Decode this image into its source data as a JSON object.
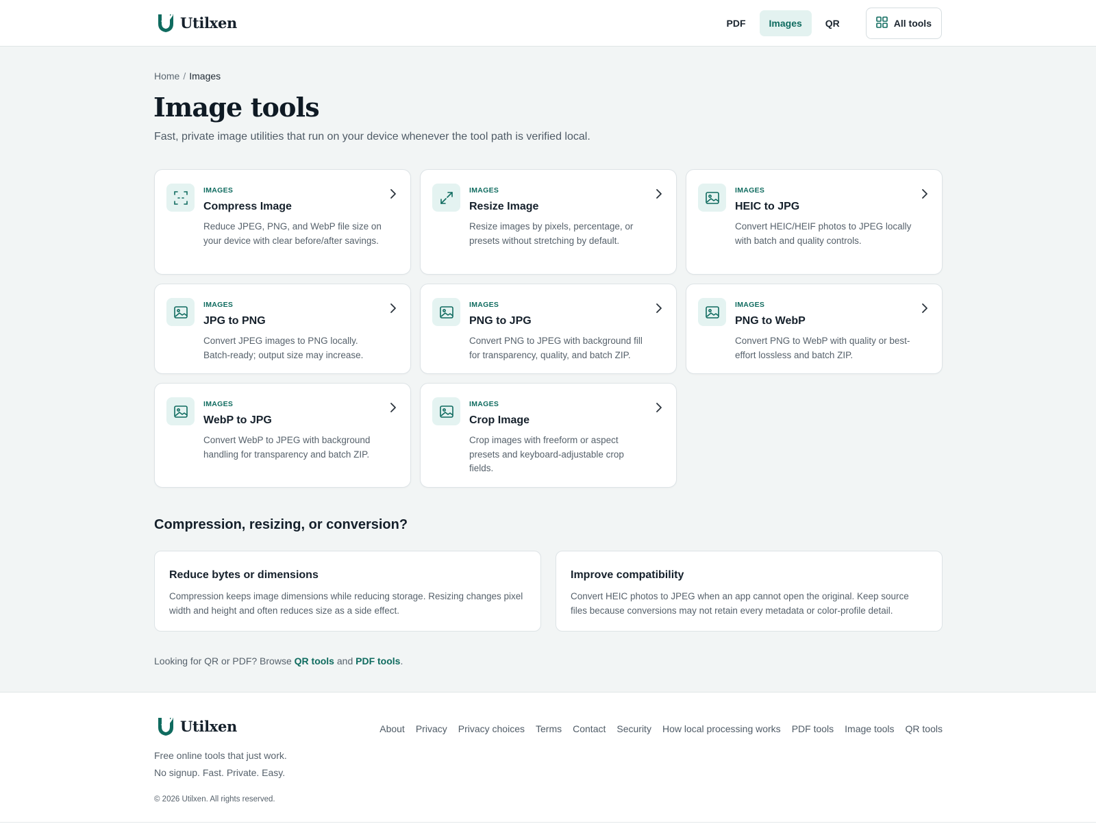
{
  "brand": {
    "name": "Utilxen",
    "logo_icon": "utilxen-logo-icon",
    "accent": "#0f6b5f"
  },
  "nav": {
    "items": [
      {
        "label": "PDF",
        "active": false
      },
      {
        "label": "Images",
        "active": true
      },
      {
        "label": "QR",
        "active": false
      }
    ],
    "all_tools_label": "All tools",
    "all_tools_icon": "grid-icon"
  },
  "breadcrumb": {
    "home": "Home",
    "separator": "/",
    "current": "Images"
  },
  "page": {
    "title": "Image tools",
    "subtitle": "Fast, private image utilities that run on your device whenever the tool path is verified local."
  },
  "tools": [
    {
      "kicker": "IMAGES",
      "title": "Compress Image",
      "desc": "Reduce JPEG, PNG, and WebP file size on your device with clear before/after savings.",
      "icon": "compress-icon"
    },
    {
      "kicker": "IMAGES",
      "title": "Resize Image",
      "desc": "Resize images by pixels, percentage, or presets without stretching by default.",
      "icon": "resize-icon"
    },
    {
      "kicker": "IMAGES",
      "title": "HEIC to JPG",
      "desc": "Convert HEIC/HEIF photos to JPEG locally with batch and quality controls.",
      "icon": "image-icon"
    },
    {
      "kicker": "IMAGES",
      "title": "JPG to PNG",
      "desc": "Convert JPEG images to PNG locally. Batch-ready; output size may increase.",
      "icon": "image-icon"
    },
    {
      "kicker": "IMAGES",
      "title": "PNG to JPG",
      "desc": "Convert PNG to JPEG with background fill for transparency, quality, and batch ZIP.",
      "icon": "image-icon"
    },
    {
      "kicker": "IMAGES",
      "title": "PNG to WebP",
      "desc": "Convert PNG to WebP with quality or best-effort lossless and batch ZIP.",
      "icon": "image-icon"
    },
    {
      "kicker": "IMAGES",
      "title": "WebP to JPG",
      "desc": "Convert WebP to JPEG with background handling for transparency and batch ZIP.",
      "icon": "image-icon"
    },
    {
      "kicker": "IMAGES",
      "title": "Crop Image",
      "desc": "Crop images with freeform or aspect presets and keyboard-adjustable crop fields.",
      "icon": "image-icon"
    }
  ],
  "compare": {
    "heading": "Compression, resizing, or conversion?",
    "cards": [
      {
        "title": "Reduce bytes or dimensions",
        "text": "Compression keeps image dimensions while reducing storage. Resizing changes pixel width and height and often reduces size as a side effect."
      },
      {
        "title": "Improve compatibility",
        "text": "Convert HEIC photos to JPEG when an app cannot open the original. Keep source files because conversions may not retain every metadata or color-profile detail."
      }
    ]
  },
  "browse": {
    "prefix": "Looking for QR or PDF? Browse ",
    "qr_link": "QR tools",
    "middle": " and ",
    "pdf_link": "PDF tools",
    "suffix": "."
  },
  "footer": {
    "tagline_1": "Free online tools that just work.",
    "tagline_2": "No signup. Fast. Private. Easy.",
    "copyright": "© 2026 Utilxen. All rights reserved.",
    "links": [
      "About",
      "Privacy",
      "Privacy choices",
      "Terms",
      "Contact",
      "Security",
      "How local processing works",
      "PDF tools",
      "Image tools",
      "QR tools"
    ]
  }
}
